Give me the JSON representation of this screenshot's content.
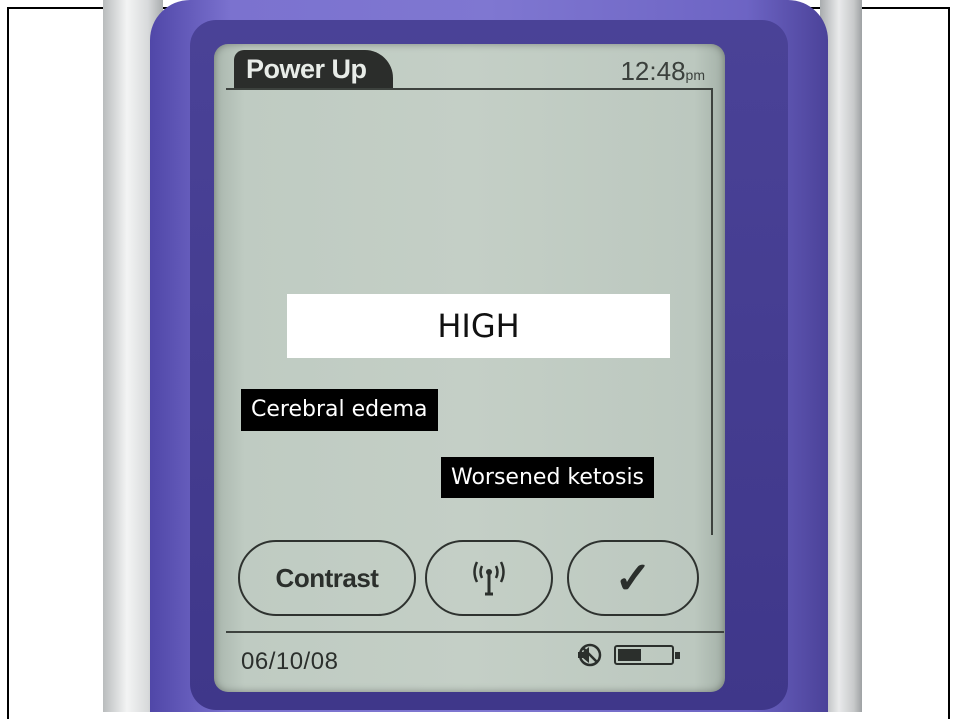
{
  "device": {
    "header_tab": "Power Up",
    "clock_time": "12:48",
    "clock_suffix": "pm",
    "date": "06/10/08"
  },
  "overlays": {
    "reading": "HIGH",
    "label_1": "Cerebral edema",
    "label_2": "Worsened ketosis"
  },
  "buttons": {
    "contrast": "Contrast",
    "wireless_icon": "wireless-antenna-icon",
    "confirm": "✓"
  },
  "status": {
    "icons": [
      "no-sound-icon",
      "battery-icon"
    ],
    "battery_level": 0.45
  }
}
